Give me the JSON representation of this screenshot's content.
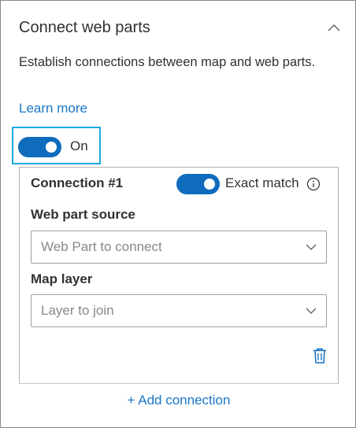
{
  "panel": {
    "title": "Connect web parts",
    "description": "Establish connections between map and web parts.",
    "learn_more": "Learn more",
    "toggle_label": "On",
    "toggle_on": true
  },
  "connection": {
    "title": "Connection #1",
    "exact_match_label": "Exact match",
    "exact_match_on": true,
    "source_label": "Web part source",
    "source_placeholder": "Web Part to connect",
    "layer_label": "Map layer",
    "layer_placeholder": "Layer to join"
  },
  "add_connection": "+ Add connection",
  "icons": {
    "collapse": "chevron-up-icon",
    "info": "info-icon",
    "dropdown": "chevron-down-icon",
    "delete": "trash-icon"
  },
  "colors": {
    "accent": "#0f6cbd",
    "link": "#1a77c9",
    "focus": "#1aa9e0"
  }
}
